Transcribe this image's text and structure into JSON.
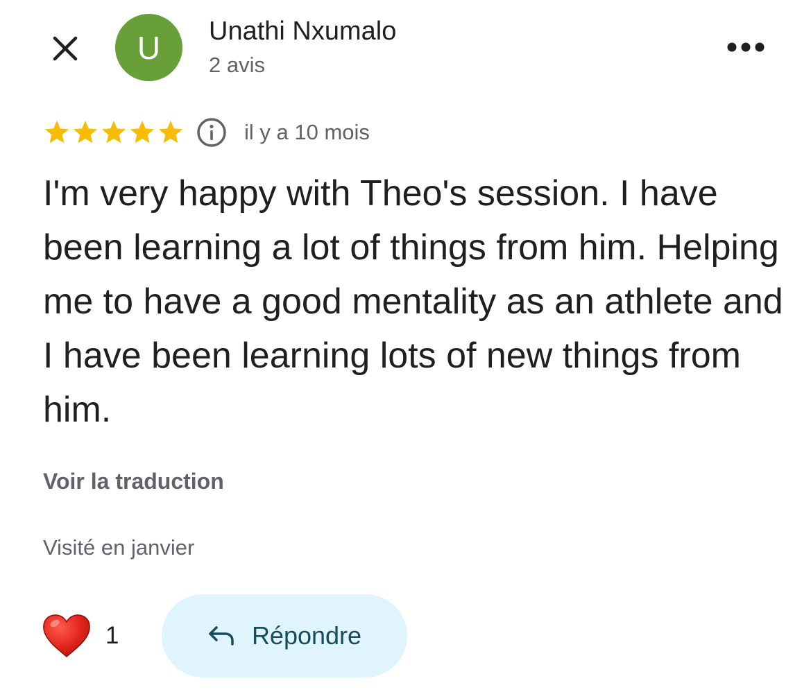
{
  "header": {
    "avatar_letter": "U",
    "avatar_color": "#689f38",
    "reviewer_name": "Unathi Nxumalo",
    "review_count": "2 avis",
    "close_icon": "close-icon",
    "more_icon": "more-horizontal-icon"
  },
  "review": {
    "rating": 5,
    "max_rating": 5,
    "star_color": "#f9bc05",
    "info_icon": "info-icon",
    "date": "il y a 10 mois",
    "text": "I'm very happy with Theo's session. I have been learning a lot of things from him. Helping me to have a good mentality as an athlete and I have been learning lots of new things from him.",
    "translate_label": "Voir la traduction",
    "visit_info": "Visité en janvier"
  },
  "actions": {
    "like_icon": "heart-icon",
    "like_color": "#e0241b",
    "like_count": "1",
    "reply_icon": "reply-arrow-icon",
    "reply_label": "Répondre",
    "reply_bg": "#dff4fc"
  }
}
